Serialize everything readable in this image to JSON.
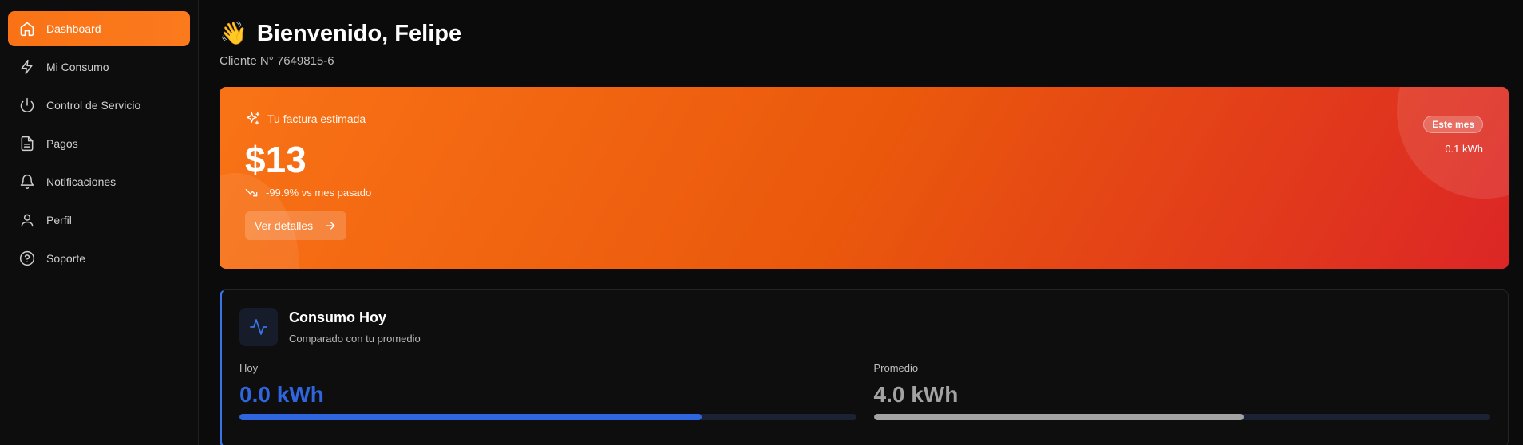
{
  "sidebar": {
    "items": [
      {
        "label": "Dashboard",
        "icon": "home-icon",
        "active": true
      },
      {
        "label": "Mi Consumo",
        "icon": "bolt-icon"
      },
      {
        "label": "Control de Servicio",
        "icon": "power-icon"
      },
      {
        "label": "Pagos",
        "icon": "document-icon"
      },
      {
        "label": "Notificaciones",
        "icon": "bell-icon"
      },
      {
        "label": "Perfil",
        "icon": "user-icon"
      },
      {
        "label": "Soporte",
        "icon": "help-circle-icon"
      }
    ]
  },
  "header": {
    "wave": "👋",
    "title": "Bienvenido, Felipe",
    "client": "Cliente N° 7649815-6"
  },
  "bill": {
    "label": "Tu factura estimada",
    "amount": "$13",
    "change": "-99.9% vs mes pasado",
    "details_button": "Ver detalles",
    "month_badge": "Este mes",
    "month_kwh": "0.1 kWh"
  },
  "consumo": {
    "title": "Consumo Hoy",
    "subtitle": "Comparado con tu promedio",
    "today_label": "Hoy",
    "today_value": "0.0 kWh",
    "today_fill_fraction": 0.75,
    "avg_label": "Promedio",
    "avg_value": "4.0 kWh",
    "avg_fill_fraction": 0.6
  },
  "colors": {
    "accent_orange": "#f97316",
    "gradient_end_red": "#dc2626",
    "blue": "#2f66e0",
    "gray_bar": "#a3a3a3"
  }
}
